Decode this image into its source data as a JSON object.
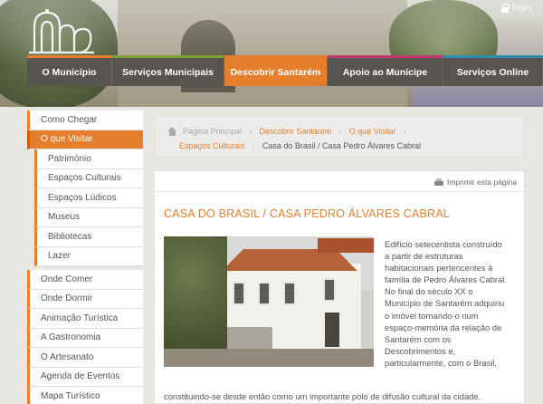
{
  "header": {
    "login_label": "login"
  },
  "nav": {
    "items": [
      {
        "label": "O Município",
        "color": "#e57f2d"
      },
      {
        "label": "Serviços Municipais",
        "color": "#7aa236"
      },
      {
        "label": "Descobrir Santarém",
        "color": "#e57f2d"
      },
      {
        "label": "Apoio ao Munícipe",
        "color": "#c0396f"
      },
      {
        "label": "Serviços Online",
        "color": "#2f8db0"
      }
    ],
    "active_index": 2
  },
  "sidebar": {
    "items": [
      {
        "label": "Como Chegar"
      },
      {
        "label": "O que Visitar"
      },
      {
        "label": "Património"
      },
      {
        "label": "Espaços Culturais"
      },
      {
        "label": "Espaços Lúdicos"
      },
      {
        "label": "Museus"
      },
      {
        "label": "Bibliotecas"
      },
      {
        "label": "Lazer"
      },
      {
        "label": "Onde Comer"
      },
      {
        "label": "Onde Dormir"
      },
      {
        "label": "Animação Turística"
      },
      {
        "label": "A Gastronomia"
      },
      {
        "label": "O Artesanato"
      },
      {
        "label": "Agenda de Eventos"
      },
      {
        "label": "Mapa Turístico"
      }
    ],
    "selected_index": 1
  },
  "breadcrumb": {
    "home": "Página Principal",
    "level1": "Descobrir Santarém",
    "level2": "O que Visitar",
    "level3": "Espaços Culturais",
    "current": "Casa do Brasil / Casa Pedro Álvares Cabral"
  },
  "content": {
    "print_label": "Imprimir esta página",
    "title": "CASA DO BRASIL / CASA PEDRO ÁLVARES CABRAL",
    "paragraph_lines": [
      "Edifício setecentista construído",
      "a partir de estruturas",
      "habitacionais pertencentes à",
      "família de Pedro Álvares Cabral.",
      "No final do século XX o",
      "Município de Santarém adquiriu",
      "o imóvel tornando-o num",
      "espaço-memória da relação de",
      "Santarém com os",
      "Descobrimentos e,",
      "particularmente, com o Brasil,"
    ],
    "continuation": "constituindo-se desde então como um importante polo de difusão cultural da cidade."
  },
  "colors": {
    "accent": "#e57f2d",
    "nav_bg": "#58544f",
    "page_bg": "#e9e7e4"
  }
}
